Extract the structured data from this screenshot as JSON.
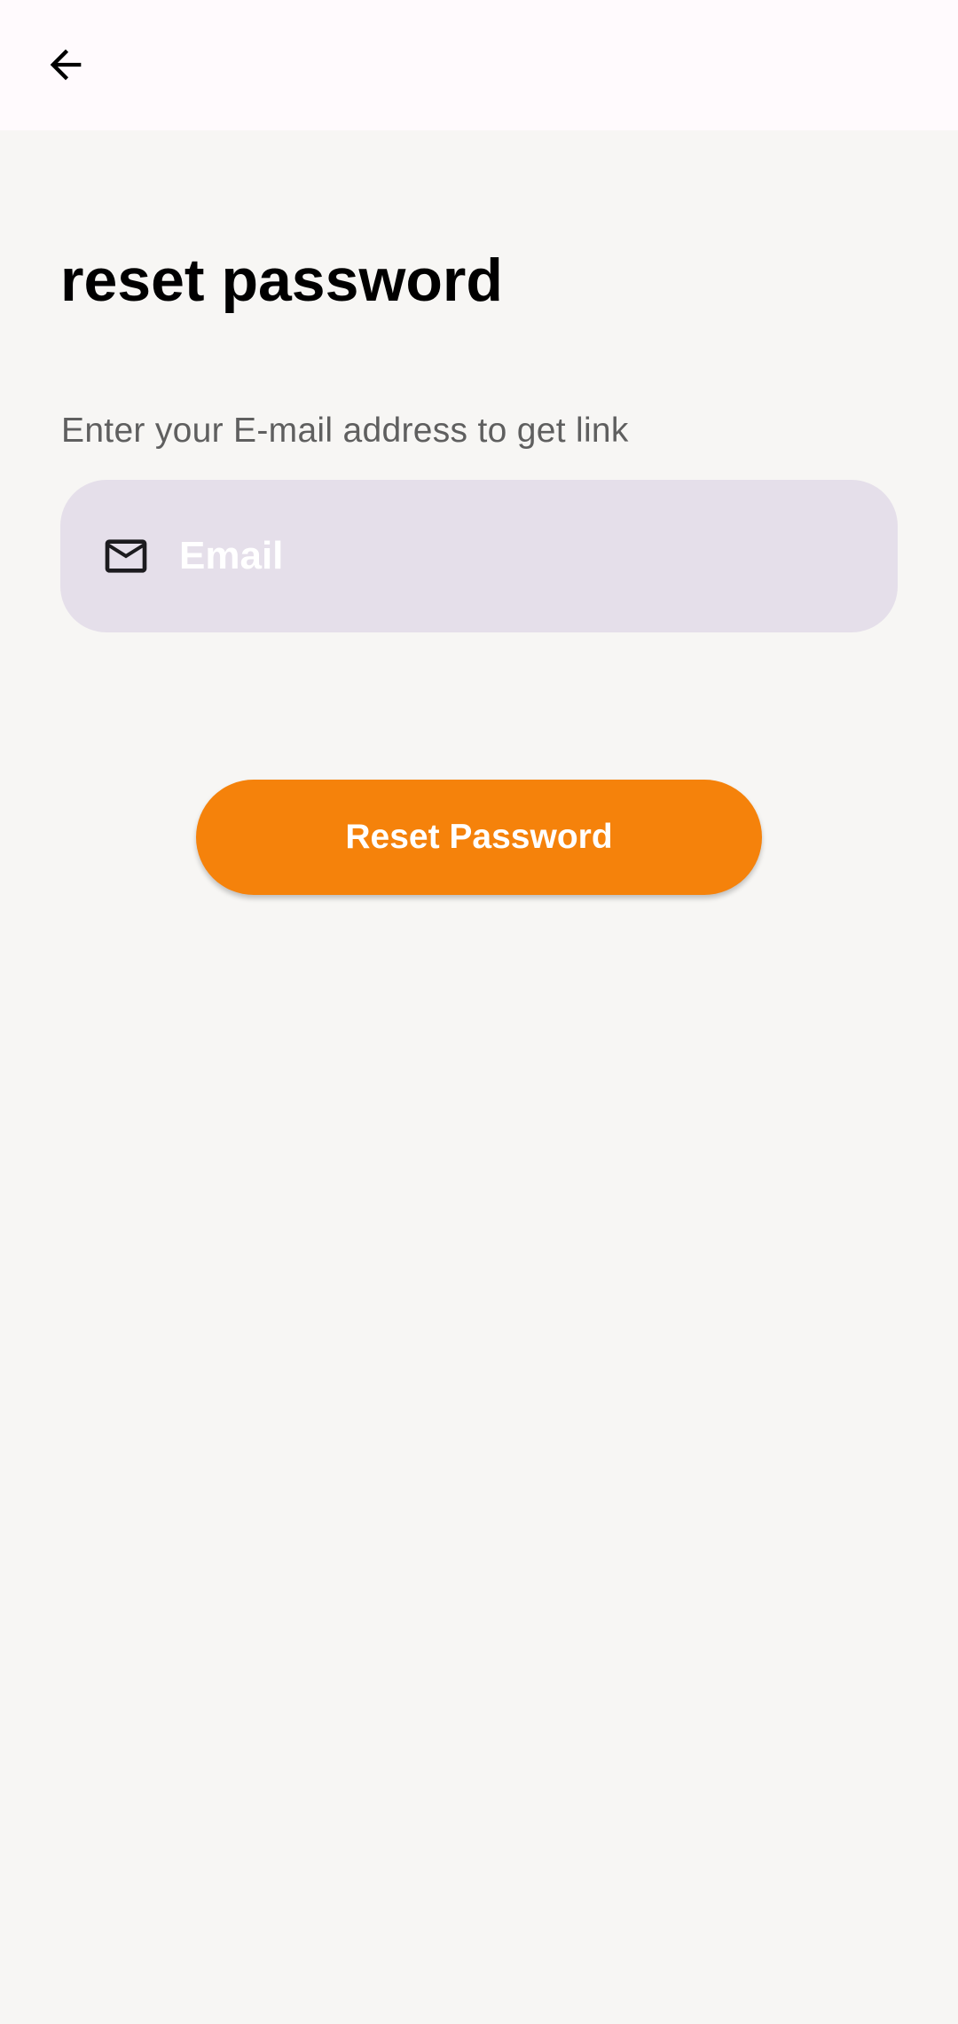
{
  "app_bar": {
    "back_icon": "arrow-left-icon",
    "background": "#fffafd"
  },
  "page": {
    "title": "reset password",
    "subtitle": "Enter your E-mail address to get link",
    "background": "#f7f6f4"
  },
  "email_field": {
    "icon": "mail-icon",
    "placeholder": "Email",
    "value": "",
    "background": "#e5dfea"
  },
  "reset_button": {
    "label": "Reset Password",
    "color": "#f5820b"
  }
}
